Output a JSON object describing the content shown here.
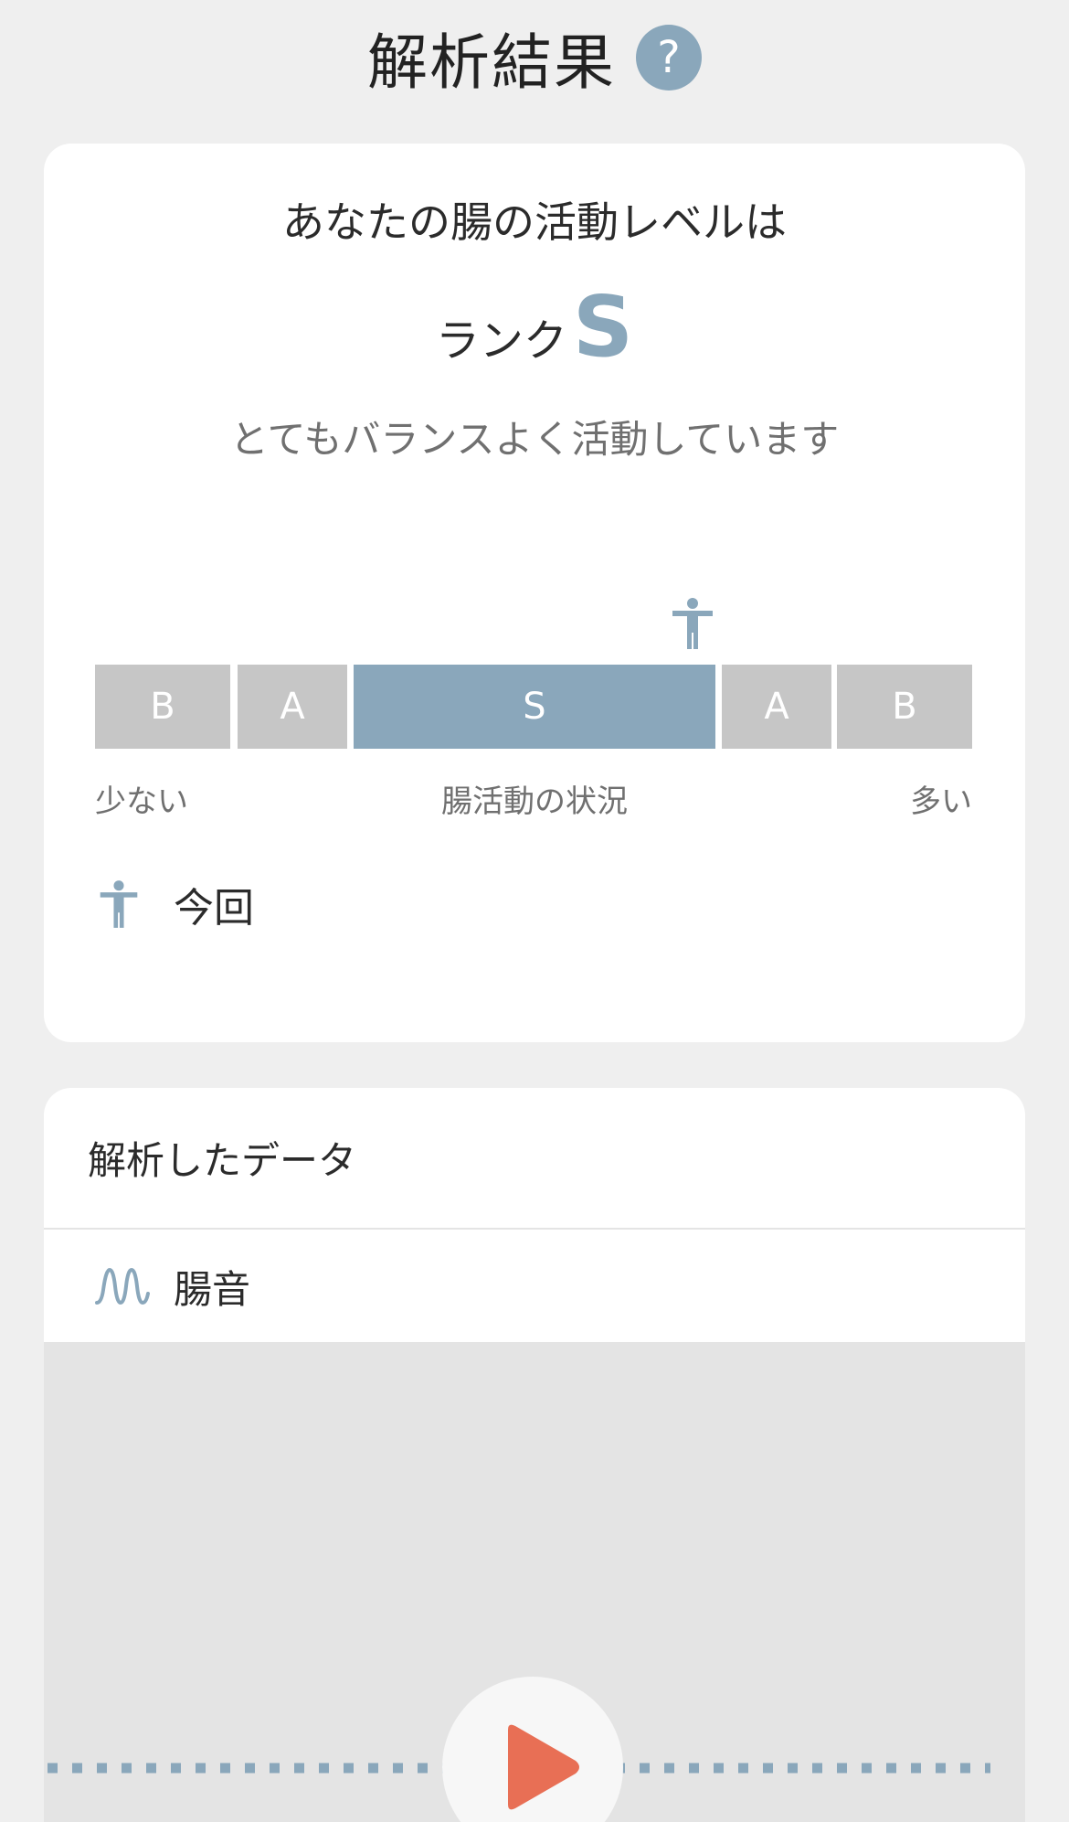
{
  "header": {
    "title": "解析結果",
    "help_label": "?"
  },
  "rank_card": {
    "lead": "あなたの腸の活動レベルは",
    "rank_label": "ランク",
    "rank_value": "S",
    "description": "とてもバランスよく活動しています",
    "gauge": {
      "segments": [
        "B",
        "A",
        "S",
        "A",
        "B"
      ],
      "active_index": 2
    },
    "scale": {
      "left": "少ない",
      "center": "腸活動の状況",
      "right": "多い"
    },
    "legend_label": "今回"
  },
  "data_card": {
    "title": "解析したデータ",
    "sound_label": "腸音"
  },
  "colors": {
    "accent": "#8aa7bb",
    "inactive": "#c6c6c6",
    "play": "#e86f55",
    "background": "#efefef"
  },
  "icons": {
    "help": "question-icon",
    "marker": "person-icon",
    "sound": "wave-icon",
    "play": "play-icon"
  }
}
